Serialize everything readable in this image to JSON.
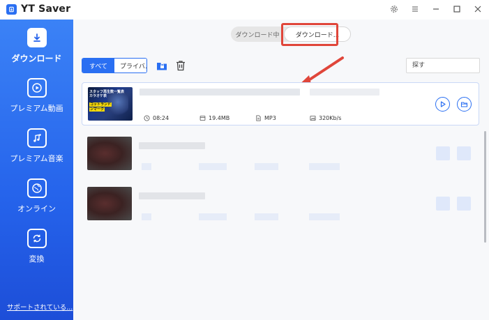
{
  "app": {
    "title": "YT Saver"
  },
  "sidebar": {
    "items": [
      {
        "label": "ダウンロード",
        "icon": "download-icon",
        "active": true
      },
      {
        "label": "プレミアム動画",
        "icon": "play-square-icon",
        "active": false
      },
      {
        "label": "プレミアム音楽",
        "icon": "music-note-icon",
        "active": false
      },
      {
        "label": "オンライン",
        "icon": "globe-icon",
        "active": false
      },
      {
        "label": "変換",
        "icon": "convert-icon",
        "active": false
      }
    ],
    "support_link": "サポートされている..."
  },
  "tabs": {
    "downloading": "ダウンロード中",
    "downloaded": "ダウンロード..."
  },
  "filters": {
    "all": "すべて",
    "private": "プライバ..."
  },
  "search": {
    "placeholder": "探す"
  },
  "items": [
    {
      "thumbnail_caption_lines": [
        "スタッフ再生数一覧表",
        "カラオケ表"
      ],
      "thumbnail_tag_lines": [
        "コットランド",
        "ンマーク"
      ],
      "duration": "08:24",
      "size": "19.4MB",
      "format": "MP3",
      "bitrate": "320Kb/s"
    }
  ],
  "colors": {
    "accent": "#2a6ff2",
    "sidebar": "#2563eb",
    "highlight": "#e0463a"
  }
}
